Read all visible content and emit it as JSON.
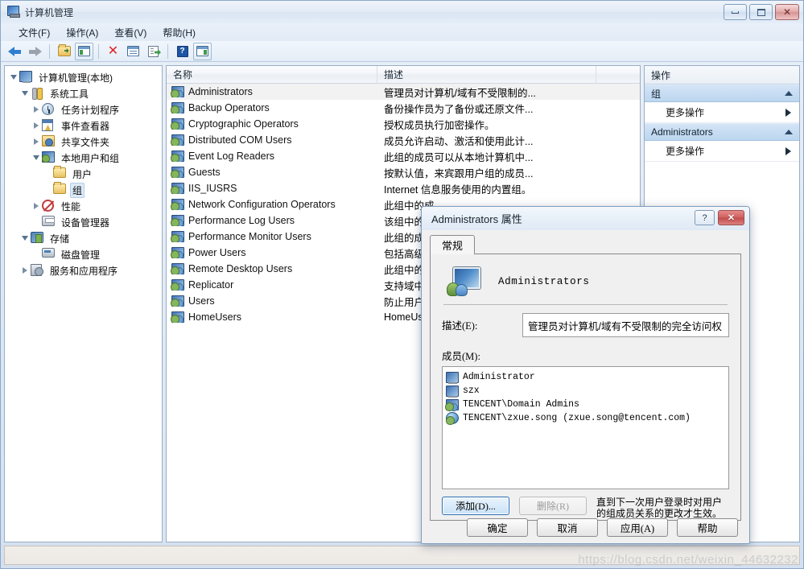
{
  "window": {
    "title": "计算机管理",
    "icon": "computer-management-icon",
    "buttons": {
      "minimize": "最小化",
      "maximize": "最大化",
      "close": "关闭"
    }
  },
  "menubar": {
    "items": [
      {
        "label": "文件(F)",
        "name": "menu-file"
      },
      {
        "label": "操作(A)",
        "name": "menu-action"
      },
      {
        "label": "查看(V)",
        "name": "menu-view"
      },
      {
        "label": "帮助(H)",
        "name": "menu-help"
      }
    ]
  },
  "toolbar": {
    "items": [
      {
        "icon": "back-arrow-icon",
        "label": "后退"
      },
      {
        "icon": "forward-arrow-icon",
        "label": "前进"
      },
      {
        "icon": "up-folder-icon",
        "label": "向上"
      },
      {
        "icon": "show-hide-tree-icon",
        "label": "显示/隐藏控制台树"
      },
      {
        "icon": "delete-x-icon",
        "label": "删除"
      },
      {
        "icon": "properties-icon",
        "label": "属性"
      },
      {
        "icon": "export-list-icon",
        "label": "导出列表"
      },
      {
        "icon": "help-question-icon",
        "label": "帮助"
      },
      {
        "icon": "show-action-pane-icon",
        "label": "显示/隐藏操作窗格"
      }
    ]
  },
  "tree": {
    "nodes": [
      {
        "label": "计算机管理(本地)",
        "icon": "computer-icon",
        "indent": 0,
        "expander": "open",
        "selected": false
      },
      {
        "label": "系统工具",
        "icon": "tools-icon",
        "indent": 1,
        "expander": "open",
        "selected": false
      },
      {
        "label": "任务计划程序",
        "icon": "clock-icon",
        "indent": 2,
        "expander": "closed",
        "selected": false
      },
      {
        "label": "事件查看器",
        "icon": "event-viewer-icon",
        "indent": 2,
        "expander": "closed",
        "selected": false
      },
      {
        "label": "共享文件夹",
        "icon": "shared-folder-icon",
        "indent": 2,
        "expander": "closed",
        "selected": false
      },
      {
        "label": "本地用户和组",
        "icon": "local-users-groups-icon",
        "indent": 2,
        "expander": "open",
        "selected": false
      },
      {
        "label": "用户",
        "icon": "folder-icon",
        "indent": 3,
        "expander": "none",
        "selected": false
      },
      {
        "label": "组",
        "icon": "folder-icon",
        "indent": 3,
        "expander": "none",
        "selected": true
      },
      {
        "label": "性能",
        "icon": "performance-icon",
        "indent": 2,
        "expander": "closed",
        "selected": false
      },
      {
        "label": "设备管理器",
        "icon": "device-manager-icon",
        "indent": 2,
        "expander": "none",
        "selected": false
      },
      {
        "label": "存储",
        "icon": "storage-icon",
        "indent": 1,
        "expander": "open",
        "selected": false
      },
      {
        "label": "磁盘管理",
        "icon": "disk-management-icon",
        "indent": 2,
        "expander": "none",
        "selected": false
      },
      {
        "label": "服务和应用程序",
        "icon": "services-apps-icon",
        "indent": 1,
        "expander": "closed",
        "selected": false
      }
    ]
  },
  "list": {
    "columns": [
      {
        "label": "名称",
        "name": "column-name"
      },
      {
        "label": "描述",
        "name": "column-description"
      },
      {
        "label": "",
        "name": "column-filler"
      }
    ],
    "rows": [
      {
        "name": "Administrators",
        "description": "管理员对计算机/域有不受限制的...",
        "selected": true
      },
      {
        "name": "Backup Operators",
        "description": "备份操作员为了备份或还原文件...",
        "selected": false
      },
      {
        "name": "Cryptographic Operators",
        "description": "授权成员执行加密操作。",
        "selected": false
      },
      {
        "name": "Distributed COM Users",
        "description": "成员允许启动、激活和使用此计...",
        "selected": false
      },
      {
        "name": "Event Log Readers",
        "description": "此组的成员可以从本地计算机中...",
        "selected": false
      },
      {
        "name": "Guests",
        "description": "按默认值，来宾跟用户组的成员...",
        "selected": false
      },
      {
        "name": "IIS_IUSRS",
        "description": "Internet 信息服务使用的内置组。",
        "selected": false
      },
      {
        "name": "Network Configuration Operators",
        "description": "此组中的成...",
        "selected": false
      },
      {
        "name": "Performance Log Users",
        "description": "该组中的成...",
        "selected": false
      },
      {
        "name": "Performance Monitor Users",
        "description": "此组的成员...",
        "selected": false
      },
      {
        "name": "Power Users",
        "description": "包括高级用...",
        "selected": false
      },
      {
        "name": "Remote Desktop Users",
        "description": "此组中的成...",
        "selected": false
      },
      {
        "name": "Replicator",
        "description": "支持域中的...",
        "selected": false
      },
      {
        "name": "Users",
        "description": "防止用户进...",
        "selected": false
      },
      {
        "name": "HomeUsers",
        "description": "HomeUse...",
        "selected": false
      }
    ]
  },
  "action_pane": {
    "title": "操作",
    "groups": [
      {
        "header": "组",
        "items": [
          {
            "label": "更多操作",
            "submenu": true
          }
        ]
      },
      {
        "header": "Administrators",
        "items": [
          {
            "label": "更多操作",
            "submenu": true
          }
        ]
      }
    ]
  },
  "dialog": {
    "title": "Administrators 属性",
    "help_button": "?",
    "close_button": "✕",
    "tabs": [
      {
        "label": "常规",
        "active": true
      }
    ],
    "group_name": "Administrators",
    "description_label": "描述(E):",
    "description_value": "管理员对计算机/域有不受限制的完全访问权",
    "members_label": "成员(M):",
    "members": [
      {
        "name": "Administrator",
        "icon": "user-icon"
      },
      {
        "name": "szx",
        "icon": "user-icon"
      },
      {
        "name": "TENCENT\\Domain Admins",
        "icon": "group-icon"
      },
      {
        "name": "TENCENT\\zxue.song (zxue.song@tencent.com)",
        "icon": "domain-user-icon"
      }
    ],
    "add_button": "添加(D)...",
    "remove_button": "删除(R)",
    "hint": "直到下一次用户登录时对用户的组成员关系的更改才生效。",
    "footer_buttons": [
      {
        "label": "确定",
        "name": "ok-button"
      },
      {
        "label": "取消",
        "name": "cancel-button"
      },
      {
        "label": "应用(A)",
        "name": "apply-button"
      },
      {
        "label": "帮助",
        "name": "help-button"
      }
    ]
  },
  "watermark": {
    "text": "https://blog.csdn.net/weixin_44632232"
  }
}
